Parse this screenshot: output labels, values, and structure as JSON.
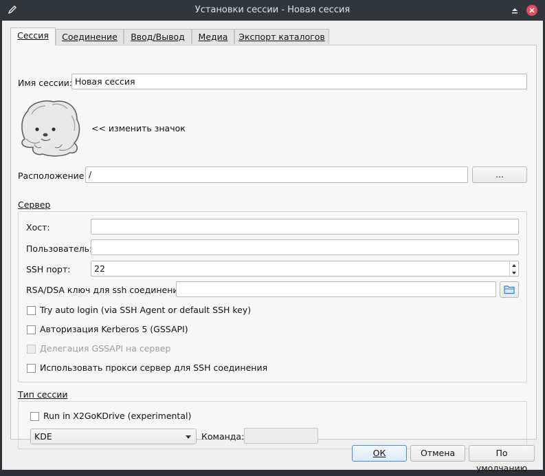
{
  "window": {
    "title": "Установки сессии - Новая сессия"
  },
  "tabs": [
    {
      "label": "Сессия",
      "active": true
    },
    {
      "label": "Соединение",
      "active": false
    },
    {
      "label": "Ввод/Вывод",
      "active": false
    },
    {
      "label": "Медиа",
      "active": false
    },
    {
      "label": "Экспорт каталогов",
      "active": false
    }
  ],
  "session": {
    "name_label": "Имя сессии:",
    "name_value": "Новая сессия",
    "change_icon_label": "<< изменить значок",
    "location_label": "Расположение:",
    "location_value": "/",
    "browse_label": "..."
  },
  "server": {
    "group_title": "Сервер",
    "host_label": "Хост:",
    "host_value": "",
    "user_label": "Пользователь:",
    "user_value": "",
    "port_label": "SSH порт:",
    "port_value": "22",
    "key_label": "RSA/DSA ключ для ssh соединения:",
    "key_value": "",
    "checkboxes": {
      "autologin": {
        "label": "Try auto login (via SSH Agent or default SSH key)",
        "checked": false
      },
      "kerberos": {
        "label": "Авторизация Kerberos 5 (GSSAPI)",
        "checked": false
      },
      "delegation": {
        "label": "Делегация GSSAPI на сервер",
        "checked": false,
        "enabled": false
      },
      "proxy": {
        "label": "Использовать прокси сервер для SSH соединения",
        "checked": false
      }
    }
  },
  "session_type": {
    "group_title": "Тип сессии",
    "kdrive": {
      "label": "Run in X2GoKDrive (experimental)",
      "checked": false
    },
    "type_value": "KDE",
    "command_label": "Команда:",
    "command_value": ""
  },
  "buttons": {
    "ok": "ОК",
    "cancel": "Отмена",
    "defaults": "По умолчанию"
  },
  "colors": {
    "titlebar": "#31363b",
    "close": "#e84b5b",
    "accent": "#3d8ee1"
  }
}
